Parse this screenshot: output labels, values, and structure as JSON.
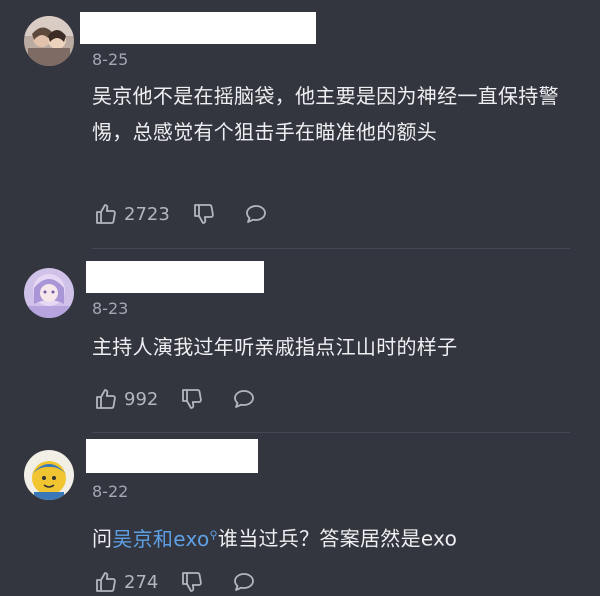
{
  "comments": [
    {
      "date": "8-25",
      "text": "吴京他不是在摇脑袋，他主要是因为神经一直保持警惕，总感觉有个狙击手在瞄准他的额头",
      "likes": "2723"
    },
    {
      "date": "8-23",
      "text": "主持人演我过年听亲戚指点江山时的样子",
      "likes": "992"
    },
    {
      "date": "8-22",
      "text_prefix": "问",
      "link_text": "吴京和exo",
      "text_suffix": "谁当过兵？答案居然是exo",
      "likes": "274"
    }
  ],
  "icons": {
    "like": "thumbs-up-icon",
    "dislike": "thumbs-down-icon",
    "reply": "comment-bubble-icon",
    "link_search": "search-icon"
  },
  "colors": {
    "background": "#34363f",
    "text": "#eeeff2",
    "meta": "#a4a7b1",
    "link": "#5ea0e6"
  }
}
